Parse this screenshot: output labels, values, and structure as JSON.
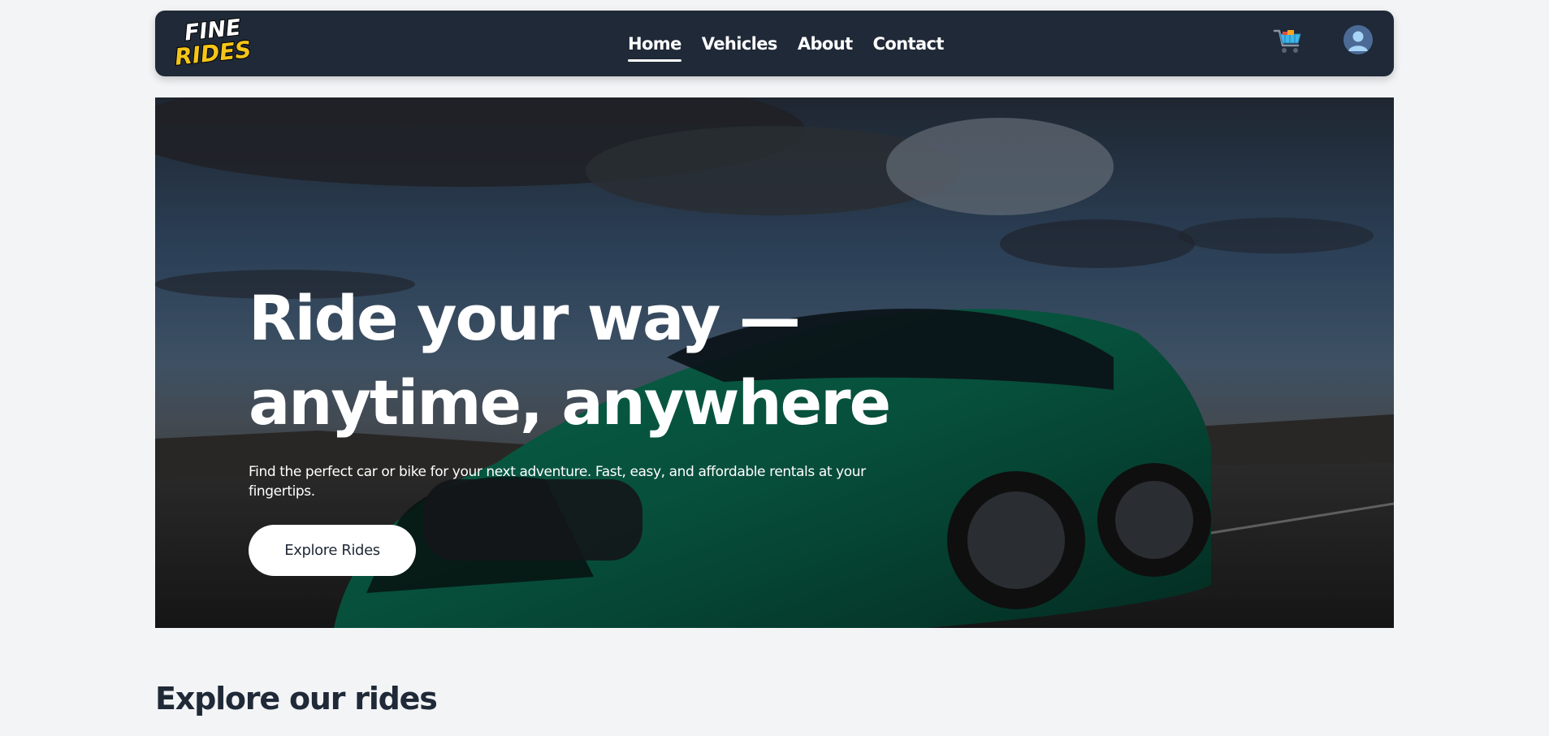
{
  "navbar": {
    "logo": {
      "line1": "FINE",
      "line2": "RIDES",
      "icon": "logo"
    },
    "links": [
      {
        "label": "Home",
        "active": true
      },
      {
        "label": "Vehicles",
        "active": false
      },
      {
        "label": "About",
        "active": false
      },
      {
        "label": "Contact",
        "active": false
      }
    ],
    "cart_icon": "shopping-cart-icon",
    "avatar_icon": "user-avatar-icon"
  },
  "hero": {
    "title": "Ride your way — anytime, anywhere",
    "subtitle": "Find the perfect car or bike for your next adventure. Fast, easy, and affordable rentals at your fingertips.",
    "button_label": "Explore Rides",
    "background": "green-sports-sedan-on-road-photo"
  },
  "section": {
    "title": "Explore our rides"
  },
  "colors": {
    "page_bg": "#f3f4f6",
    "navbar_bg": "#1f2937",
    "logo_yellow": "#f5c518",
    "car_green": "#0f6b50",
    "text_dark": "#1f2937",
    "white": "#ffffff"
  }
}
